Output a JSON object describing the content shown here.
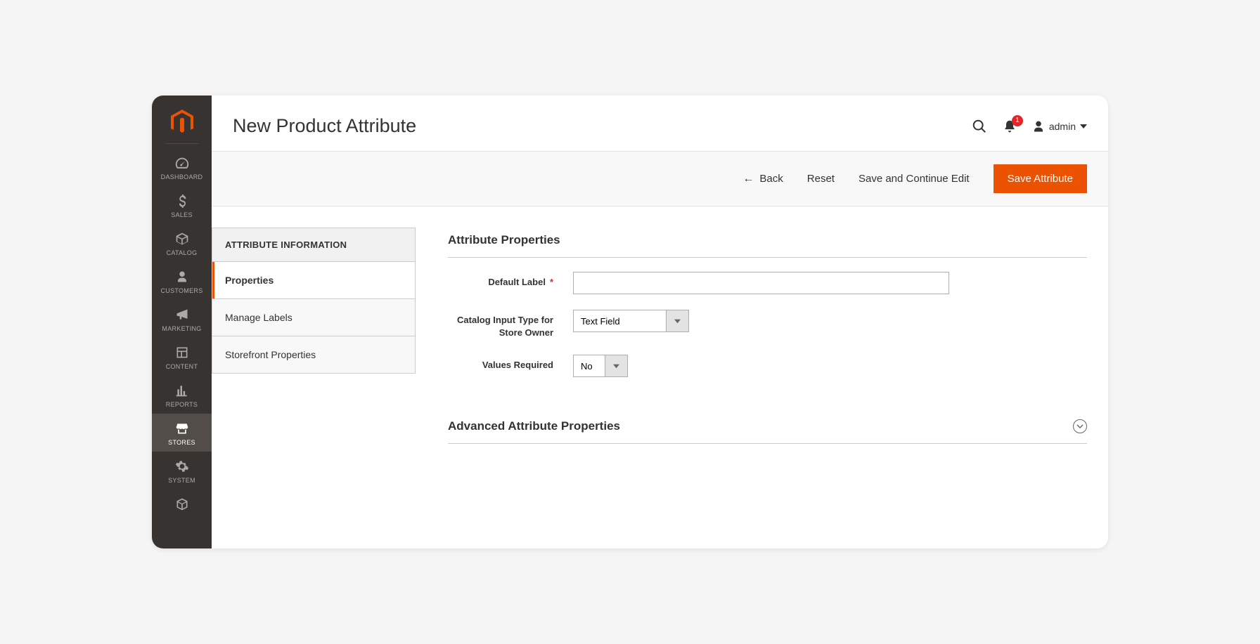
{
  "sidebar": {
    "items": [
      {
        "label": "DASHBOARD"
      },
      {
        "label": "SALES"
      },
      {
        "label": "CATALOG"
      },
      {
        "label": "CUSTOMERS"
      },
      {
        "label": "MARKETING"
      },
      {
        "label": "CONTENT"
      },
      {
        "label": "REPORTS"
      },
      {
        "label": "STORES"
      },
      {
        "label": "SYSTEM"
      },
      {
        "label": ""
      }
    ]
  },
  "header": {
    "title": "New Product Attribute",
    "notif_count": "1",
    "user": "admin"
  },
  "actions": {
    "back": "Back",
    "reset": "Reset",
    "save_continue": "Save and Continue Edit",
    "save": "Save Attribute"
  },
  "tabs": {
    "header": "ATTRIBUTE INFORMATION",
    "items": [
      {
        "label": "Properties"
      },
      {
        "label": "Manage Labels"
      },
      {
        "label": "Storefront Properties"
      }
    ]
  },
  "form": {
    "section1": "Attribute Properties",
    "fields": {
      "default_label": {
        "label": "Default Label",
        "value": ""
      },
      "input_type": {
        "label": "Catalog Input Type for Store Owner",
        "value": "Text Field"
      },
      "values_required": {
        "label": "Values Required",
        "value": "No"
      }
    },
    "section2": "Advanced Attribute Properties"
  }
}
